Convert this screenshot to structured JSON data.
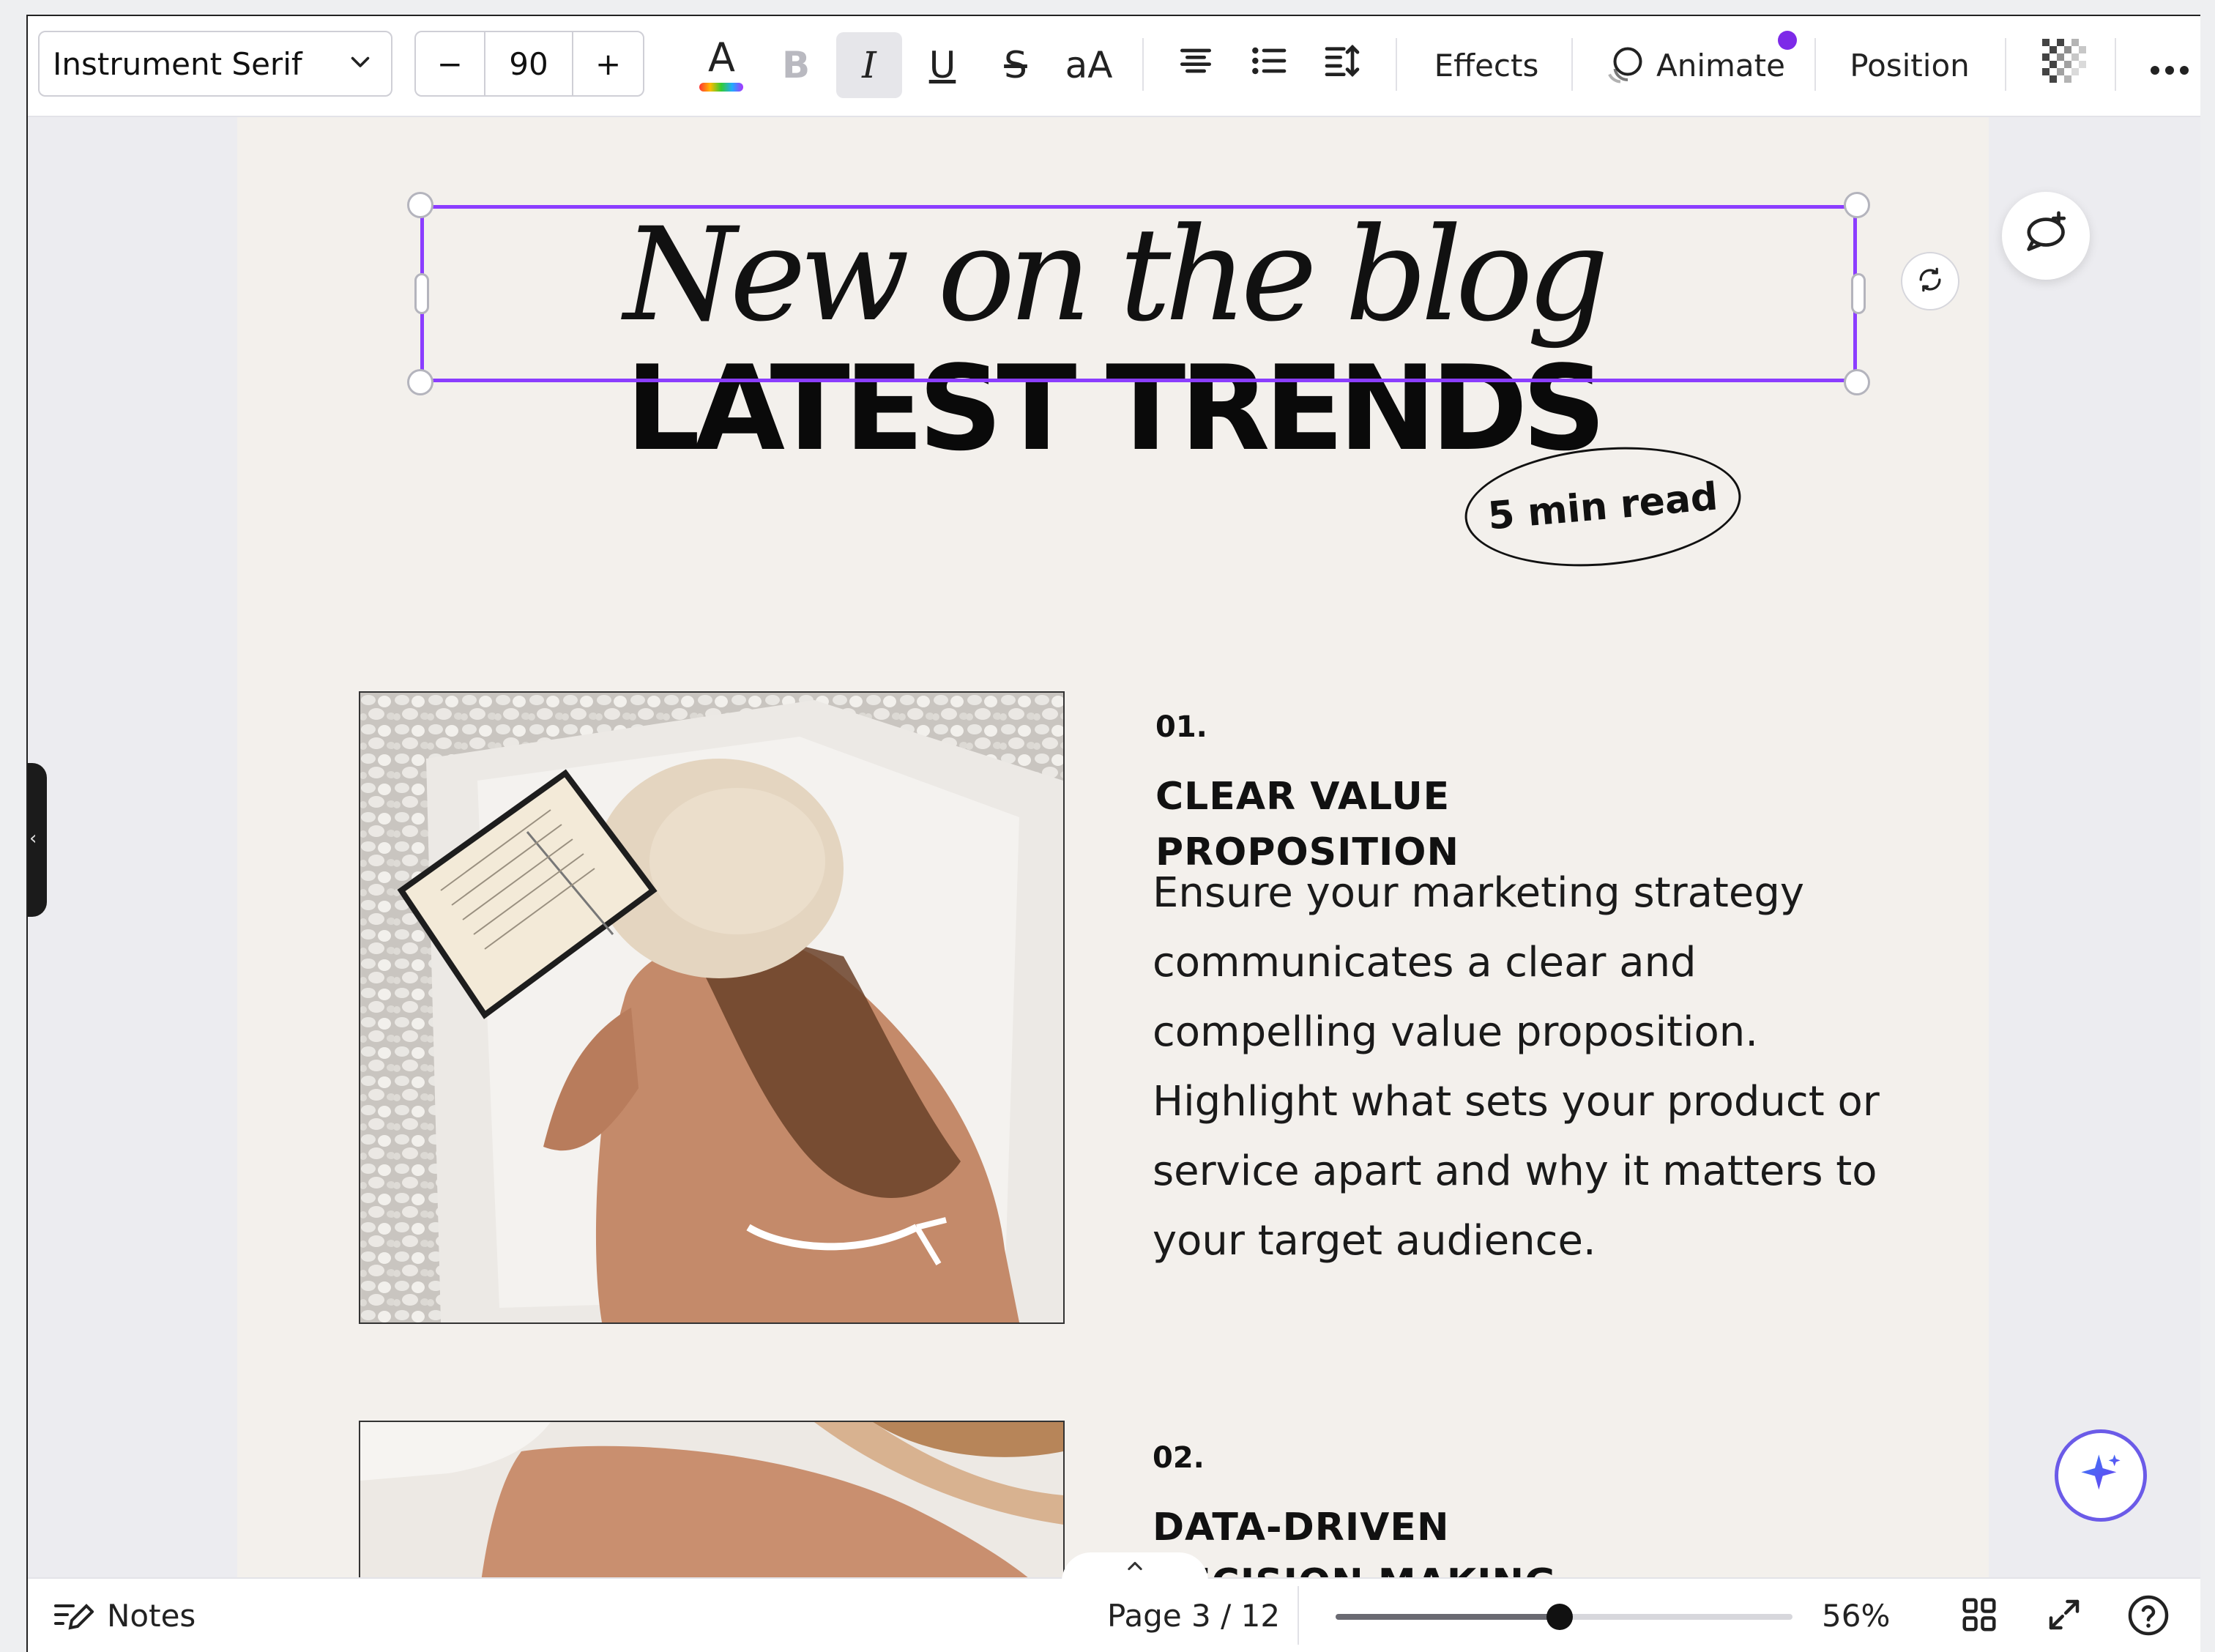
{
  "toolbar": {
    "font_family": "Instrument Serif",
    "font_size": "90",
    "minus": "−",
    "plus": "+",
    "text_color_glyph": "A",
    "bold_glyph": "B",
    "italic_glyph": "I",
    "underline_glyph": "U",
    "strike_glyph": "S",
    "case_glyph": "aA",
    "effects_label": "Effects",
    "animate_label": "Animate",
    "position_label": "Position",
    "icons": [
      "chevron-down-icon",
      "text-color-icon",
      "bold-icon",
      "italic-icon",
      "underline-icon",
      "strikethrough-icon",
      "letter-case-icon",
      "align-center-icon",
      "bulleted-list-icon",
      "line-spacing-icon",
      "animate-icon",
      "transparency-icon",
      "more-icon"
    ]
  },
  "canvas": {
    "script_title": "New on the blog",
    "bold_title": "LATEST TRENDS",
    "badge": "5 min read",
    "items": [
      {
        "num": "01.",
        "title_line1": "CLEAR VALUE",
        "title_line2": "PROPOSITION",
        "body": [
          "Ensure your marketing strategy",
          "communicates a clear and",
          "compelling value proposition.",
          "Highlight what sets your product or",
          "service apart and why it matters to",
          "your target audience."
        ]
      },
      {
        "num": "02.",
        "title_line1": "DATA-DRIVEN",
        "title_line2": "DECISION MAKING"
      }
    ]
  },
  "bottombar": {
    "notes_label": "Notes",
    "page_indicator": "Page 3 / 12",
    "zoom": "56%",
    "zoom_fraction": 0.49
  },
  "colors": {
    "selection": "#8b3dff",
    "page_bg": "#f3f0ec",
    "workspace_bg": "#ececf0",
    "notification_dot": "#7d2ae8"
  }
}
